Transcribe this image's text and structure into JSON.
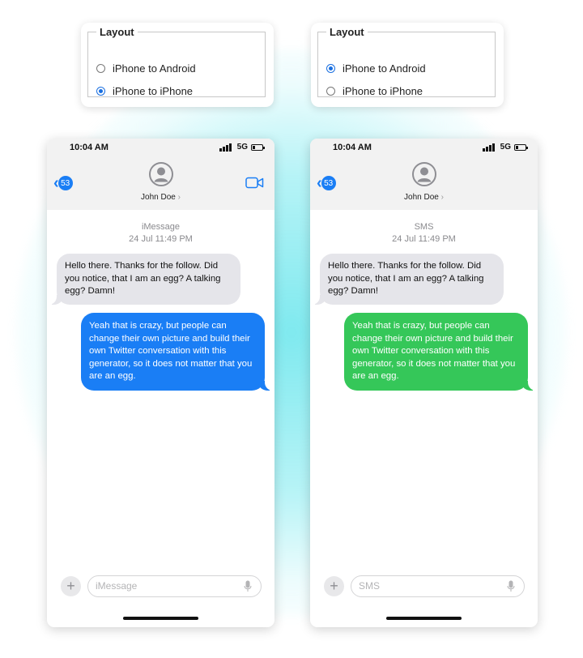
{
  "layouts": [
    {
      "legend": "Layout",
      "options": [
        {
          "label": "iPhone to Android",
          "checked": false
        },
        {
          "label": "iPhone to iPhone",
          "checked": true
        }
      ]
    },
    {
      "legend": "Layout",
      "options": [
        {
          "label": "iPhone to Android",
          "checked": true
        },
        {
          "label": "iPhone to iPhone",
          "checked": false
        }
      ]
    }
  ],
  "phones": [
    {
      "time": "10:04 AM",
      "network": "5G",
      "back_count": "53",
      "contact_name": "John Doe",
      "contact_arrow": "›",
      "service": "iMessage",
      "timestamp": "24 Jul 11:49 PM",
      "incoming": "Hello there. Thanks for the follow. Did you notice, that I am an egg? A talking egg? Damn!",
      "outgoing": "Yeah that is crazy, but people can change their own picture and build their own Twitter conversation with this generator, so it does not matter that you are an egg.",
      "outgoing_color": "#1a7ef5",
      "compose_placeholder": "iMessage"
    },
    {
      "time": "10:04 AM",
      "network": "5G",
      "back_count": "53",
      "contact_name": "John Doe",
      "contact_arrow": "›",
      "service": "SMS",
      "timestamp": "24 Jul 11:49 PM",
      "incoming": "Hello there. Thanks for the follow. Did you notice, that I am an egg? A talking egg? Damn!",
      "outgoing": "Yeah that is crazy, but people can change their own picture and build their own Twitter conversation with this generator, so it does not matter that you are an egg.",
      "outgoing_color": "#35c759",
      "compose_placeholder": "SMS"
    }
  ],
  "icons": {
    "back": "chevron-left-icon",
    "avatar": "person-avatar-icon",
    "video": "video-camera-icon",
    "plus": "plus-icon",
    "mic": "microphone-icon",
    "signal": "signal-bars-icon",
    "battery": "battery-icon"
  }
}
